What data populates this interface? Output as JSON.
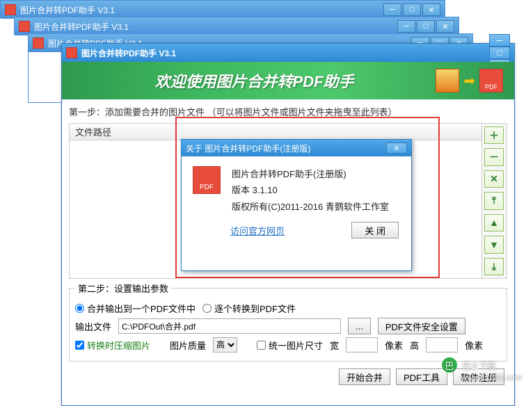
{
  "app_title": "图片合并转PDF助手 V3.1",
  "bg_titles": [
    "图片合并转PDF助手 V3.1",
    "图片合并转PDF助手 V3.1",
    "图片合并转PDF助手 V3.1"
  ],
  "banner": {
    "slogan": "欢迎使用图片合并转PDF助手",
    "pdf_label": "PDF"
  },
  "step1": {
    "label": "第一步：添加需要合并的图片文件 （可以将图片文件或图片文件夹拖曳至此列表）",
    "header": "文件路径"
  },
  "side_buttons": {
    "add": "＋",
    "remove": "－",
    "clear": "✕",
    "top": "⤒",
    "up": "▲",
    "down": "▼",
    "bottom": "⤓"
  },
  "step2": {
    "legend": "第二步：设置输出参数",
    "merge_one": "合并输出到一个PDF文件中",
    "each_one": "逐个转换到PDF文件",
    "output_label": "输出文件",
    "output_path": "C:\\PDFOut\\合并.pdf",
    "browse": "...",
    "security": "PDF文件安全设置",
    "compress": "转换时压缩图片",
    "quality_label": "图片质量",
    "quality_value": "高",
    "unify": "统一图片尺寸",
    "width_label": "宽",
    "width_unit": "像素",
    "height_label": "高",
    "height_unit": "像素"
  },
  "bottom": {
    "start": "开始合并",
    "tools": "PDF工具",
    "register": "软件注册"
  },
  "about": {
    "title": "关于 图片合并转PDF助手(注册版)",
    "name": "图片合并转PDF助手(注册版)",
    "version": "版本 3.1.10",
    "copyright": "版权所有(C)2011-2016 青鹦软件工作室",
    "link": "访问官方网页",
    "close": "关 闭",
    "icon_label": "PDF"
  },
  "watermark": {
    "logo_text": "巴",
    "text": "巴士下载",
    "url": "www.11684.com"
  }
}
